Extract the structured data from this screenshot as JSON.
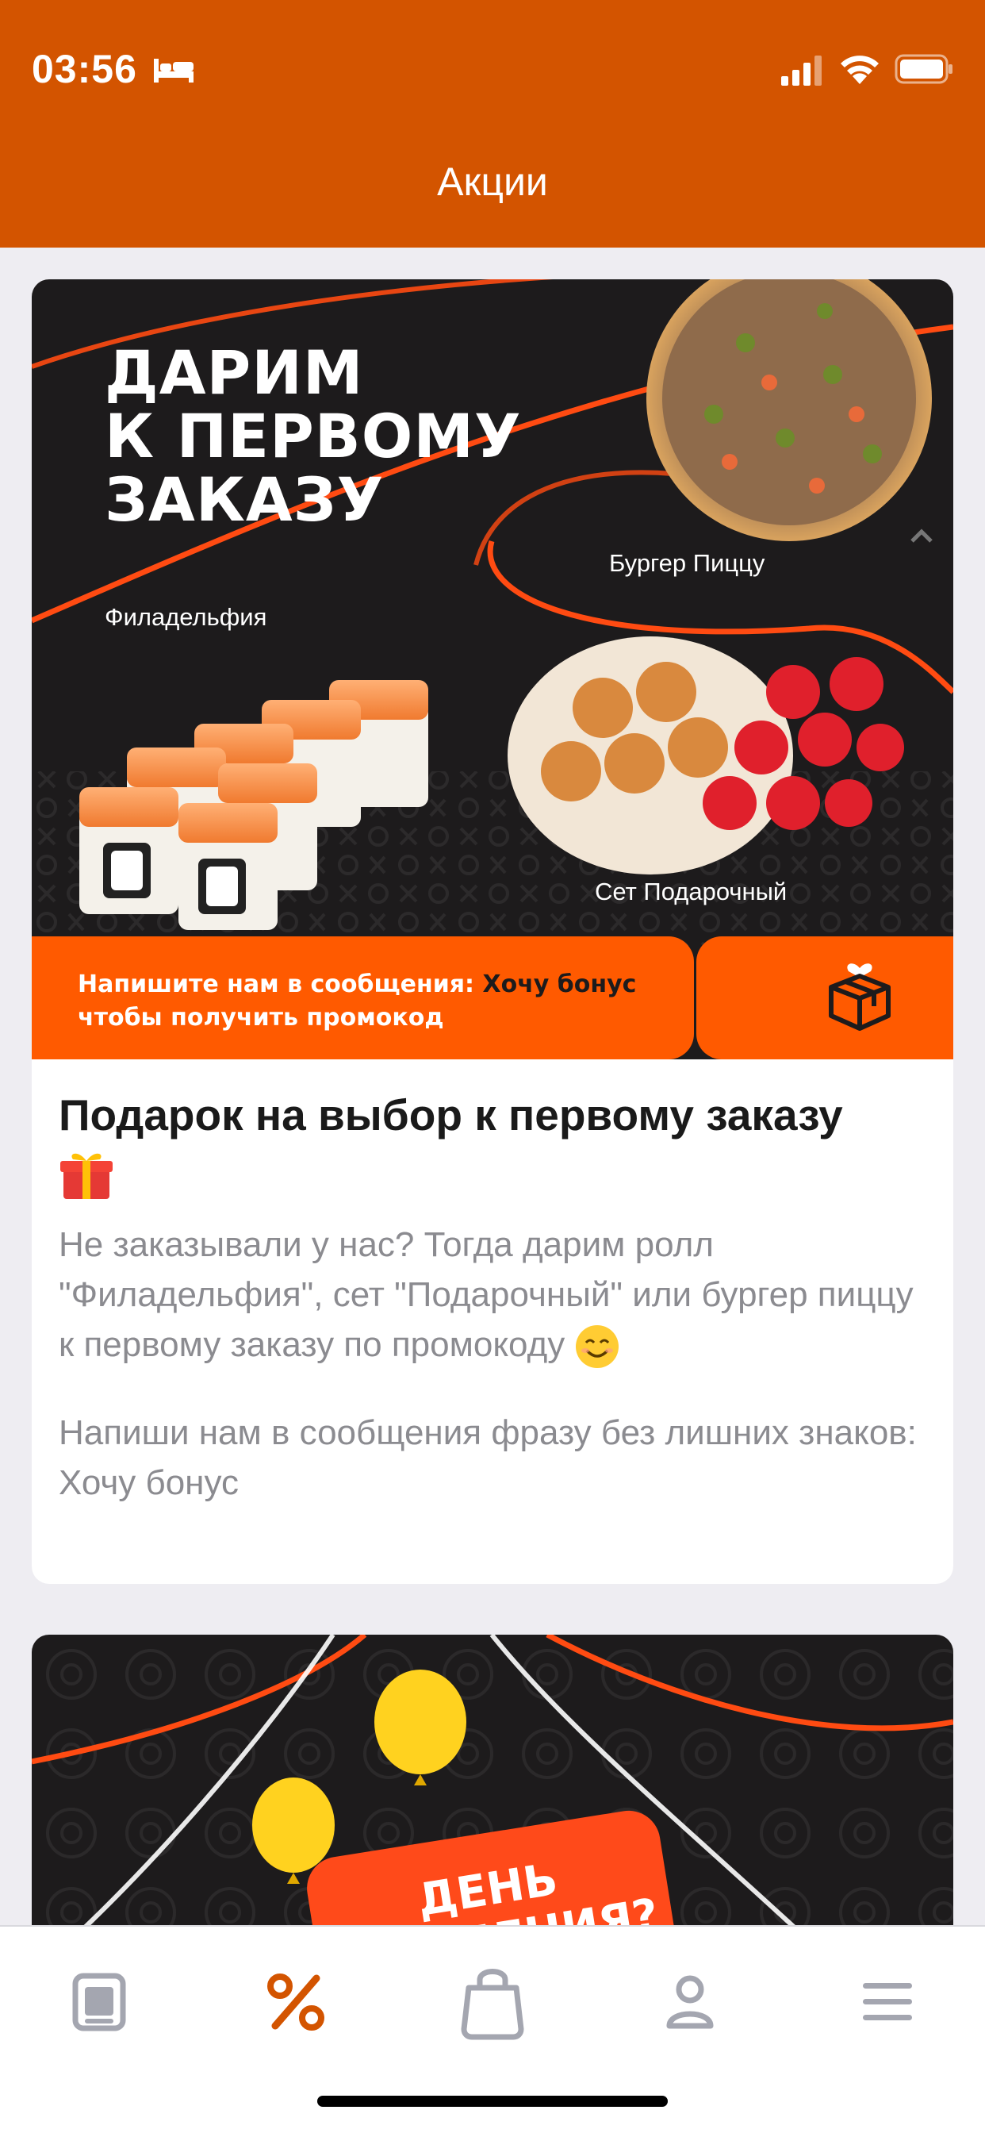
{
  "status_bar": {
    "time": "03:56",
    "icons": [
      "bed-icon",
      "cellular-signal-icon",
      "wifi-icon",
      "battery-icon"
    ]
  },
  "header": {
    "title": "Акции",
    "background_color": "#d35400"
  },
  "promo_card": {
    "banner": {
      "headline_lines": [
        "ДАРИМ",
        "К ПЕРВОМУ",
        "ЗАКАЗУ"
      ],
      "product_labels": {
        "philadelphia": "Филадельфия",
        "burger_pizza": "Бургер Пиццу",
        "gift_set": "Сет Подарочный"
      },
      "strip_line1_prefix": "Напишите нам в сообщения: ",
      "strip_line1_keyword": "Хочу бонус",
      "strip_line2": "чтобы получить промокод",
      "accent_color": "#ff5a00"
    },
    "title": "Подарок на выбор к первому заказу",
    "description": "Не заказывали у нас? Тогда дарим ролл \"Филадельфия\", сет \"Подарочный\" или бургер пиццу к первому заказу по промокоду",
    "instruction": "Напиши нам в сообщения фразу без лишних знаков: Хочу бонус"
  },
  "birthday_card": {
    "tag_line1": "ДЕНЬ",
    "tag_line2": "РОЖДЕНИЯ?"
  },
  "tab_bar": {
    "items": [
      {
        "icon": "menu-catalog-icon",
        "active": false
      },
      {
        "icon": "percent-promotions-icon",
        "active": true
      },
      {
        "icon": "shopping-bag-icon",
        "active": false
      },
      {
        "icon": "profile-icon",
        "active": false
      },
      {
        "icon": "hamburger-menu-icon",
        "active": false
      }
    ],
    "active_color": "#d35400",
    "inactive_color": "#a4a6b0"
  }
}
